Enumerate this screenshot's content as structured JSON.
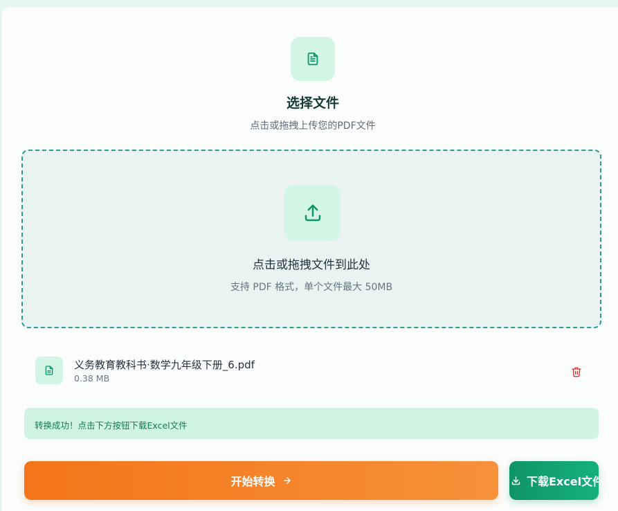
{
  "header": {
    "title": "选择文件",
    "subtitle": "点击或拖拽上传您的PDF文件",
    "icon": "document-icon"
  },
  "dropzone": {
    "title": "点击或拖拽文件到此处",
    "hint": "支持 PDF 格式，单个文件最大 50MB",
    "icon": "upload-icon"
  },
  "file": {
    "name": "义务教育教科书·数学九年级下册_6.pdf",
    "size": "0.38 MB",
    "icon": "document-icon",
    "delete_icon": "trash-icon"
  },
  "status": {
    "message": "转换成功！点击下方按钮下载Excel文件"
  },
  "actions": {
    "convert_label": "开始转换",
    "convert_icon": "arrow-right-icon",
    "download_label": "下载Excel文件",
    "download_icon": "download-icon"
  },
  "colors": {
    "accent_green": "#0f9468",
    "accent_orange": "#f47519",
    "danger_red": "#e0312f"
  }
}
